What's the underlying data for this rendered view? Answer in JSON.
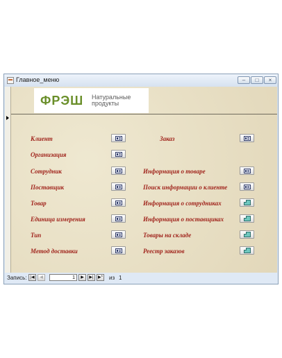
{
  "window": {
    "title": "Главное_меню"
  },
  "logo": {
    "mark": "ФРЭШ",
    "sub_line1": "Натуральные",
    "sub_line2": "продукты"
  },
  "menu": {
    "left": [
      {
        "label": "Клиент",
        "icon": "form-icon"
      },
      {
        "label": "Организация",
        "icon": "form-icon"
      },
      {
        "label": "Сотрудник",
        "icon": "form-icon"
      },
      {
        "label": "Поставщик",
        "icon": "form-icon"
      },
      {
        "label": "Товар",
        "icon": "form-icon"
      },
      {
        "label": "Единица измерения",
        "icon": "form-icon"
      },
      {
        "label": "Тип",
        "icon": "form-icon"
      },
      {
        "label": "Метод доставки",
        "icon": "form-icon"
      }
    ],
    "right": [
      {
        "label": "Заказ",
        "icon": "form-icon"
      },
      {
        "label": "Информация о товаре",
        "icon": "form-icon"
      },
      {
        "label": "Поиск информации о клиенте",
        "icon": "form-icon"
      },
      {
        "label": "Информация о сотрудниках",
        "icon": "report-icon"
      },
      {
        "label": "Информация о поставщиках",
        "icon": "report-icon"
      },
      {
        "label": "Товары на складе",
        "icon": "report-icon"
      },
      {
        "label": "Реестр заказов",
        "icon": "report-icon"
      }
    ]
  },
  "navigation": {
    "label": "Запись:",
    "current": "1",
    "of_label": "из",
    "total": "1",
    "first_glyph": "|◀",
    "prev_glyph": "◀",
    "next_glyph": "▶",
    "last_glyph": "▶|",
    "new_glyph": "▶*"
  },
  "controls": {
    "minimize": "–",
    "maximize": "□",
    "close": "×"
  }
}
